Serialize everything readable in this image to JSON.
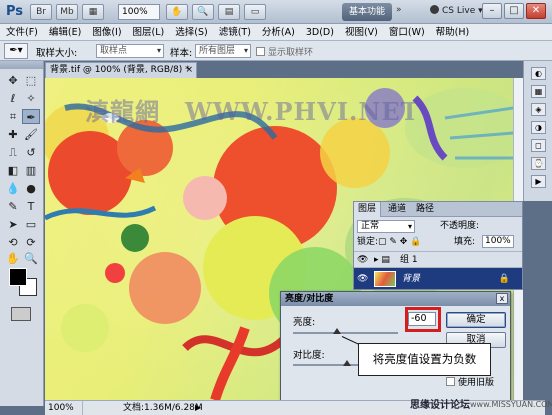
{
  "titlebar": {
    "app_logo": "Ps",
    "zoom": "100%",
    "workspace_button": "基本功能",
    "workspace_arrow": "»",
    "cs_live": "CS Live",
    "window_minimize": "–",
    "window_restore": "□",
    "window_close": "✕"
  },
  "menu": [
    "文件(F)",
    "编辑(E)",
    "图像(I)",
    "图层(L)",
    "选择(S)",
    "滤镜(T)",
    "分析(A)",
    "3D(D)",
    "视图(V)",
    "窗口(W)",
    "帮助(H)"
  ],
  "options": {
    "sample_size_label": "取样大小:",
    "sample_size_value": "取样点",
    "sample_label": "样本:",
    "sample_value": "所有图层",
    "show_ring_label": "显示取样环"
  },
  "document": {
    "tab_title": "背景.tif @ 100% (背景, RGB/8) *",
    "tab_close": "×",
    "watermark": "滇龍網　WWW.PHVI.NET"
  },
  "status": {
    "zoom": "100%",
    "doc_size": "文档:1.36M/6.28M",
    "arrow": "▶"
  },
  "layers_panel": {
    "tabs": [
      "图层",
      "通道",
      "路径"
    ],
    "blend_mode": "正常",
    "opacity_label": "不透明度:",
    "lock_label": "锁定:",
    "fill_label": "填充:",
    "fill_value": "100%",
    "layers": [
      {
        "name": "组 1",
        "selected": false
      },
      {
        "name": "背景",
        "selected": true
      }
    ]
  },
  "dialog": {
    "title": "亮度/对比度",
    "close": "x",
    "brightness_label": "亮度:",
    "brightness_value": "-60",
    "contrast_label": "对比度:",
    "ok_button": "确定",
    "cancel_button": "取消",
    "legacy_label": "使用旧版"
  },
  "callout": {
    "text": "将亮度值设置为负数"
  },
  "site": {
    "name": "思缘设计论坛",
    "url": "www.MISSYUAN.COM"
  }
}
